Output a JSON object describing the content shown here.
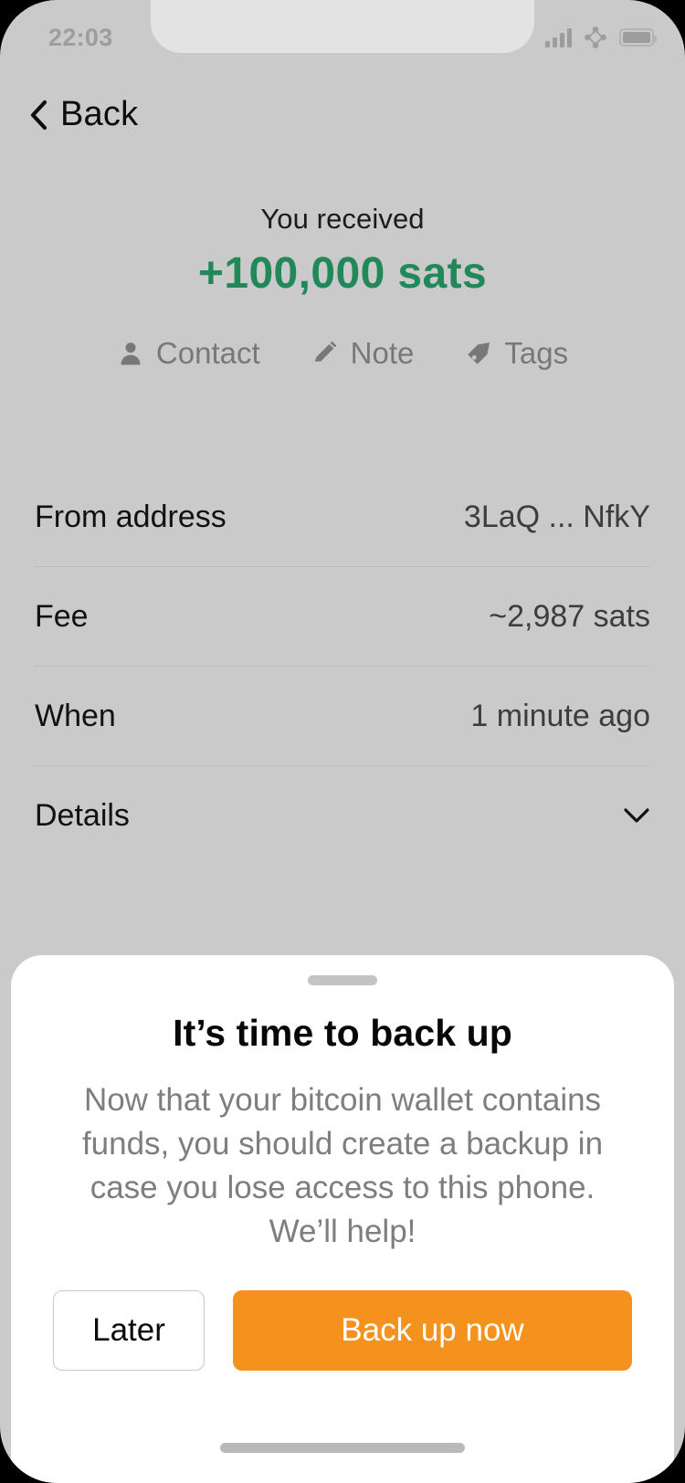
{
  "status_bar": {
    "time": "22:03",
    "icons": [
      "signal-bars-icon",
      "network-icon",
      "battery-icon"
    ]
  },
  "nav": {
    "back_label": "Back",
    "back_icon": "chevron-left-icon"
  },
  "transaction": {
    "received_label": "You received",
    "amount": "+100,000 sats",
    "amount_color": "#22885a",
    "actions": [
      {
        "label": "Contact",
        "icon": "person-icon"
      },
      {
        "label": "Note",
        "icon": "pencil-icon"
      },
      {
        "label": "Tags",
        "icon": "tag-icon"
      }
    ],
    "details": [
      {
        "key": "From address",
        "value": "3LaQ ... NfkY"
      },
      {
        "key": "Fee",
        "value": "~2,987 sats"
      },
      {
        "key": "When",
        "value": "1 minute ago"
      },
      {
        "key": "Details",
        "value": "",
        "icon": "chevron-down-icon"
      }
    ]
  },
  "backup_sheet": {
    "handle": "drag-handle",
    "title": "It’s time to back up",
    "body": "Now that your bitcoin wallet contains funds, you should create a backup in case you lose access to this phone. We’ll help!",
    "secondary_button": "Later",
    "primary_button": "Back up now",
    "primary_color": "#f5921e"
  }
}
